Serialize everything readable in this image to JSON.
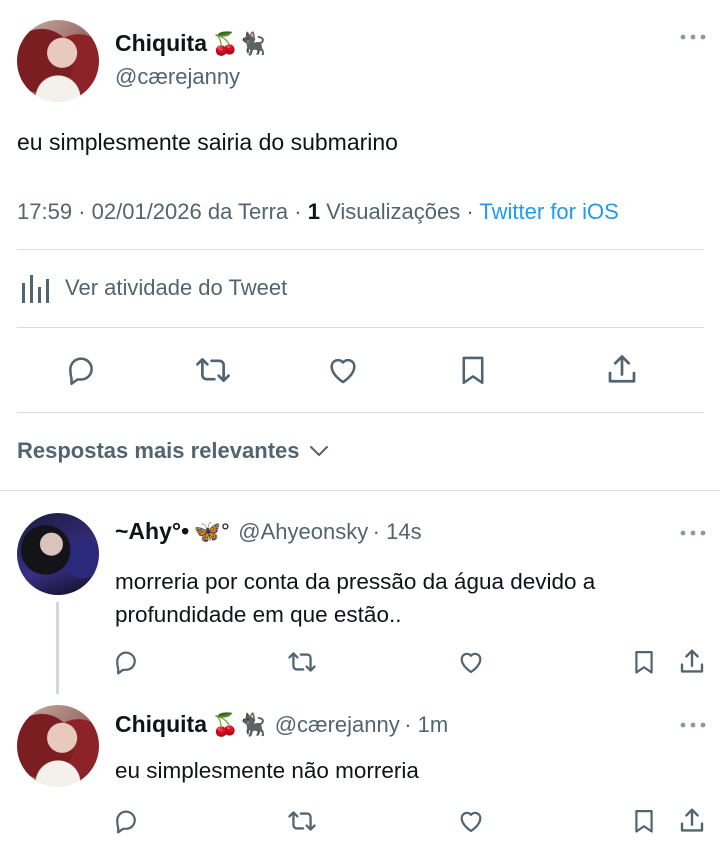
{
  "main_tweet": {
    "name": "Chiquita",
    "name_emoji": "🍒🐈‍⬛",
    "handle": "@cærejanny",
    "text": "eu simplesmente sairia do submarino",
    "time": "17:59",
    "date": "02/01/2026 da Terra",
    "views_count": "1",
    "views_label": "Visualizações",
    "source": "Twitter for iOS",
    "activity_label": "Ver atividade do Tweet"
  },
  "replies_header": "Respostas mais relevantes",
  "replies": [
    {
      "name": "~Ahy°•",
      "name_emoji_after": "🦋°",
      "handle": "@Ahyeonsky",
      "time": "14s",
      "text_line1": "morreria por conta da pressão da água devido a",
      "text_line2": "profundidade em que estão.."
    },
    {
      "name": "Chiquita",
      "name_emoji": "🍒🐈‍⬛",
      "handle": "@cærejanny",
      "time": "1m",
      "text": "eu simplesmente não morreria"
    }
  ],
  "icons": {
    "more": "more-icon",
    "reply": "reply-icon",
    "retweet": "retweet-icon",
    "like": "heart-icon",
    "bookmark": "bookmark-icon",
    "share": "share-icon",
    "analytics": "analytics-icon",
    "chevron": "chevron-down-icon"
  },
  "colors": {
    "accent": "#1d9bf0",
    "text": "#0f1419",
    "secondary": "#536471",
    "divider": "#d7dde1"
  }
}
